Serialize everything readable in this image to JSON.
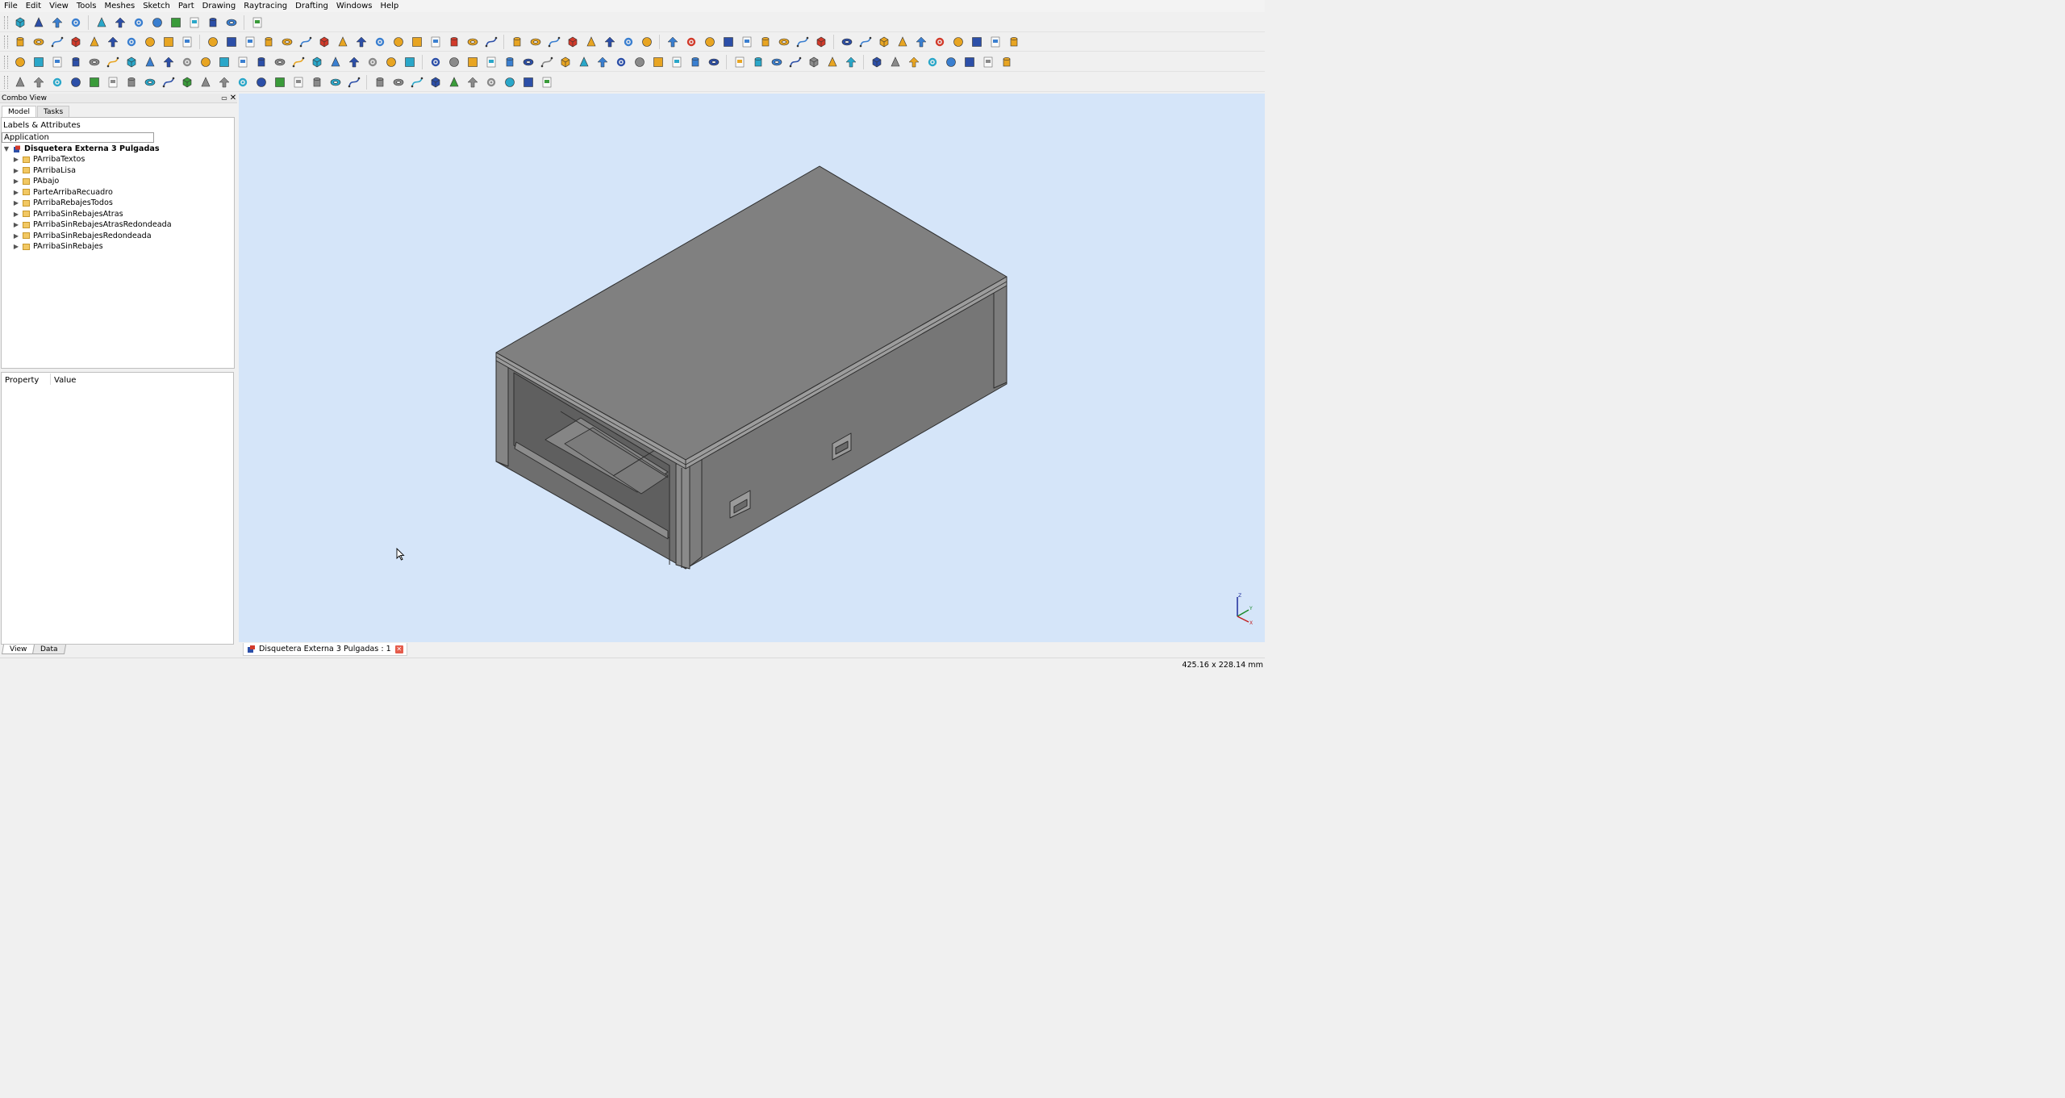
{
  "menubar": [
    "File",
    "Edit",
    "View",
    "Tools",
    "Meshes",
    "Sketch",
    "Part",
    "Drawing",
    "Raytracing",
    "Drafting",
    "Windows",
    "Help"
  ],
  "toolbar_colors": [
    "#e8a522",
    "#3a7fd0",
    "#2aa7c9",
    "#d23a2a",
    "#3a9b3a",
    "#8a8a8a",
    "#2c4fa8"
  ],
  "combo": {
    "title": "Combo View",
    "tabs": [
      "Model",
      "Tasks"
    ],
    "tree_header": "Labels & Attributes",
    "app_field": "Application",
    "document": "Disquetera Externa 3 Pulgadas",
    "items": [
      "PArribaTextos",
      "PArribaLisa",
      "PAbajo",
      "ParteArribaRecuadro",
      "PArribaRebajesTodos",
      "PArribaSinRebajesAtras",
      "PArribaSinRebajesAtrasRedondeada",
      "PArribaSinRebajesRedondeada",
      "PArribaSinRebajes"
    ]
  },
  "property": {
    "col_property": "Property",
    "col_value": "Value"
  },
  "bottom_tabs": [
    "View",
    "Data"
  ],
  "view_tab": {
    "label": "Disquetera Externa 3 Pulgadas : 1"
  },
  "axis": {
    "z": "Z",
    "y": "Y",
    "x": "X"
  },
  "status": {
    "dimensions": "425.16 x 228.14 mm"
  },
  "colors": {
    "viewport": "#d5e5f9",
    "model_top": "#808080",
    "model_side": "#747474"
  }
}
